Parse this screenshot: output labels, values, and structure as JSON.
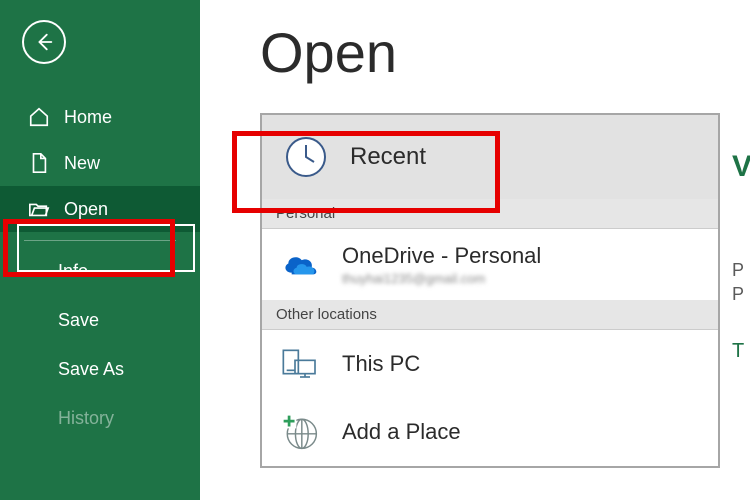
{
  "sidebar": {
    "items": [
      {
        "label": "Home"
      },
      {
        "label": "New"
      },
      {
        "label": "Open"
      }
    ],
    "sub_items": [
      {
        "label": "Info"
      },
      {
        "label": "Save"
      },
      {
        "label": "Save As"
      },
      {
        "label": "History"
      }
    ]
  },
  "page": {
    "title": "Open"
  },
  "locations": {
    "recent_label": "Recent",
    "personal_header": "Personal",
    "onedrive": {
      "label": "OneDrive - Personal",
      "sub": "thuyhai1235@gmail.com"
    },
    "other_header": "Other locations",
    "this_pc_label": "This PC",
    "add_place_label": "Add a Place"
  },
  "right_peek": {
    "p1": "V",
    "p2": "P",
    "p3": "P",
    "p4": "T"
  }
}
